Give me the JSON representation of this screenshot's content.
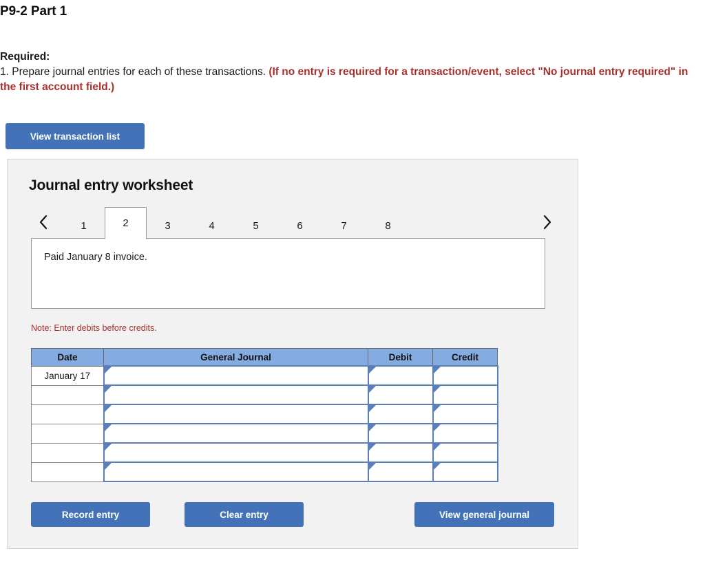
{
  "page_title": "P9-2 Part 1",
  "required": {
    "label": "Required:",
    "instruction_plain": "1. Prepare journal entries for each of these transactions.",
    "instruction_emphasis": "(If no entry is required for a transaction/event, select \"No journal entry required\" in the first account field.)"
  },
  "toolbar": {
    "view_transaction_list_label": "View transaction list"
  },
  "worksheet": {
    "title": "Journal entry worksheet",
    "prev_icon": "chevron-left-icon",
    "next_icon": "chevron-right-icon",
    "tabs": [
      {
        "label": "1",
        "active": false
      },
      {
        "label": "2",
        "active": true
      },
      {
        "label": "3",
        "active": false
      },
      {
        "label": "4",
        "active": false
      },
      {
        "label": "5",
        "active": false
      },
      {
        "label": "6",
        "active": false
      },
      {
        "label": "7",
        "active": false
      },
      {
        "label": "8",
        "active": false
      }
    ],
    "active_tab": "2",
    "description": "Paid January 8 invoice.",
    "note": "Note: Enter debits before credits.",
    "table": {
      "headers": [
        "Date",
        "General Journal",
        "Debit",
        "Credit"
      ],
      "rows": [
        {
          "date": "January 17",
          "general_journal": "",
          "debit": "",
          "credit": ""
        },
        {
          "date": "",
          "general_journal": "",
          "debit": "",
          "credit": ""
        },
        {
          "date": "",
          "general_journal": "",
          "debit": "",
          "credit": ""
        },
        {
          "date": "",
          "general_journal": "",
          "debit": "",
          "credit": ""
        },
        {
          "date": "",
          "general_journal": "",
          "debit": "",
          "credit": ""
        },
        {
          "date": "",
          "general_journal": "",
          "debit": "",
          "credit": ""
        }
      ]
    },
    "buttons": {
      "record_entry": "Record entry",
      "clear_entry": "Clear entry",
      "view_general_journal": "View general journal"
    }
  },
  "colors": {
    "button_blue": "#4472b8",
    "header_blue": "#84ace0",
    "alert_red": "#a7302c",
    "panel_gray": "#f2f2f2",
    "cell_border_blue": "#5a7fba"
  }
}
